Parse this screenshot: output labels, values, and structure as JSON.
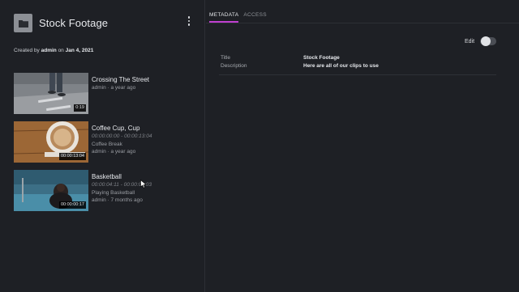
{
  "collection": {
    "title": "Stock Footage",
    "created_prefix": "Created by ",
    "created_user": "admin",
    "created_mid": " on ",
    "created_date": "Jan 4, 2021"
  },
  "clips": [
    {
      "title": "Crossing The Street",
      "duration": "0:19",
      "line1": "admin · a year ago"
    },
    {
      "title": "Coffee Cup, Cup",
      "duration": "00:00:13:04",
      "range": "00:00:00:00 - 00:00:13:04",
      "subtitle": "Coffee Break",
      "meta": "admin · a year ago"
    },
    {
      "title": "Basketball",
      "duration": "00:00:00:17",
      "range": "00:00:04:11 - 00:00:05:03",
      "subtitle": "Playing Basketball",
      "meta": "admin · 7 months ago"
    }
  ],
  "tabs": [
    "METADATA",
    "ACCESS"
  ],
  "edit_label": "Edit",
  "metadata": {
    "title_key": "Title",
    "title_val": "Stock Footage",
    "desc_key": "Description",
    "desc_val": "Here are all of our clips to use"
  },
  "colors": {
    "accent": "#c040d0",
    "background": "#1e2025"
  }
}
